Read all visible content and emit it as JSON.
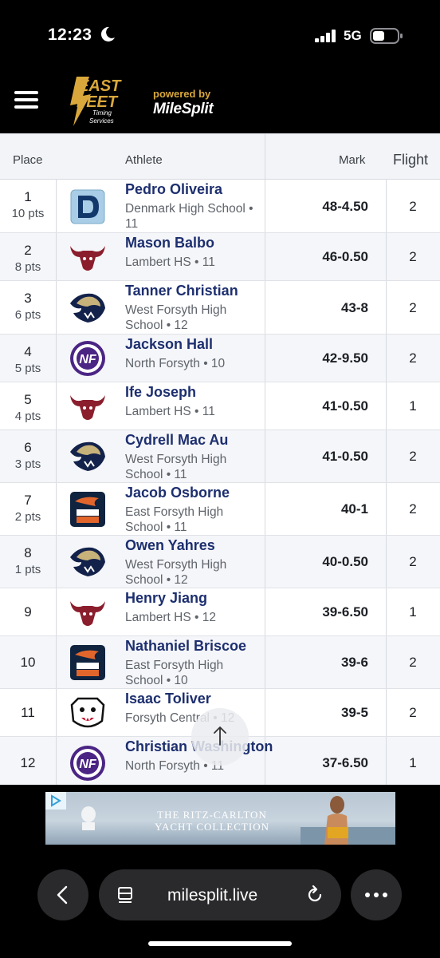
{
  "status_bar": {
    "time": "12:23",
    "network": "5G"
  },
  "header": {
    "powered_by": "powered by",
    "brand": "MileSplit",
    "logo_text_1": "EAST",
    "logo_text_2": "FEET",
    "logo_text_3": "Timing",
    "logo_text_4": "Services"
  },
  "table": {
    "columns": {
      "place": "Place",
      "athlete": "Athlete",
      "mark": "Mark",
      "flight": "Flight"
    },
    "rows": [
      {
        "place": "1",
        "pts": "10 pts",
        "name": "Pedro Oliveira",
        "school": "Denmark High School • 11",
        "mark": "48-4.50",
        "flight": "2",
        "logo": "denmark-d-logo"
      },
      {
        "place": "2",
        "pts": "8 pts",
        "name": "Mason Balbo",
        "school": "Lambert HS • 11",
        "mark": "46-0.50",
        "flight": "2",
        "logo": "longhorn-logo"
      },
      {
        "place": "3",
        "pts": "6 pts",
        "name": "Tanner Christian",
        "school": "West Forsyth High School • 12",
        "mark": "43-8",
        "flight": "2",
        "logo": "wolverine-logo"
      },
      {
        "place": "4",
        "pts": "5 pts",
        "name": "Jackson Hall",
        "school": "North Forsyth • 10",
        "mark": "42-9.50",
        "flight": "2",
        "logo": "raiders-nf-logo"
      },
      {
        "place": "5",
        "pts": "4 pts",
        "name": "Ife Joseph",
        "school": "Lambert HS • 11",
        "mark": "41-0.50",
        "flight": "1",
        "logo": "longhorn-logo"
      },
      {
        "place": "6",
        "pts": "3 pts",
        "name": "Cydrell Mac Au",
        "school": "West Forsyth High School • 11",
        "mark": "41-0.50",
        "flight": "2",
        "logo": "wolverine-logo"
      },
      {
        "place": "7",
        "pts": "2 pts",
        "name": "Jacob Osborne",
        "school": "East Forsyth High School • 11",
        "mark": "40-1",
        "flight": "2",
        "logo": "east-bronco-logo"
      },
      {
        "place": "8",
        "pts": "1 pts",
        "name": "Owen Yahres",
        "school": "West Forsyth High School • 12",
        "mark": "40-0.50",
        "flight": "2",
        "logo": "wolverine-logo"
      },
      {
        "place": "9",
        "pts": "",
        "name": "Henry Jiang",
        "school": "Lambert HS • 12",
        "mark": "39-6.50",
        "flight": "1",
        "logo": "longhorn-logo"
      },
      {
        "place": "10",
        "pts": "",
        "name": "Nathaniel Briscoe",
        "school": "East Forsyth High School • 10",
        "mark": "39-6",
        "flight": "2",
        "logo": "east-bronco-logo"
      },
      {
        "place": "11",
        "pts": "",
        "name": "Isaac Toliver",
        "school": "Forsyth Central • 12",
        "mark": "39-5",
        "flight": "2",
        "logo": "bulldog-logo"
      },
      {
        "place": "12",
        "pts": "",
        "name": "Christian Washington",
        "school": "North Forsyth • 11",
        "mark": "37-6.50",
        "flight": "1",
        "logo": "raiders-nf-logo"
      }
    ]
  },
  "ad": {
    "title_line1": "THE RITZ-CARLTON",
    "title_line2": "YACHT COLLECTION"
  },
  "browser": {
    "url": "milesplit.live"
  },
  "colors": {
    "name": "#1d2f6f",
    "header_bg": "#000000",
    "accent_gold": "#d9a73b"
  }
}
